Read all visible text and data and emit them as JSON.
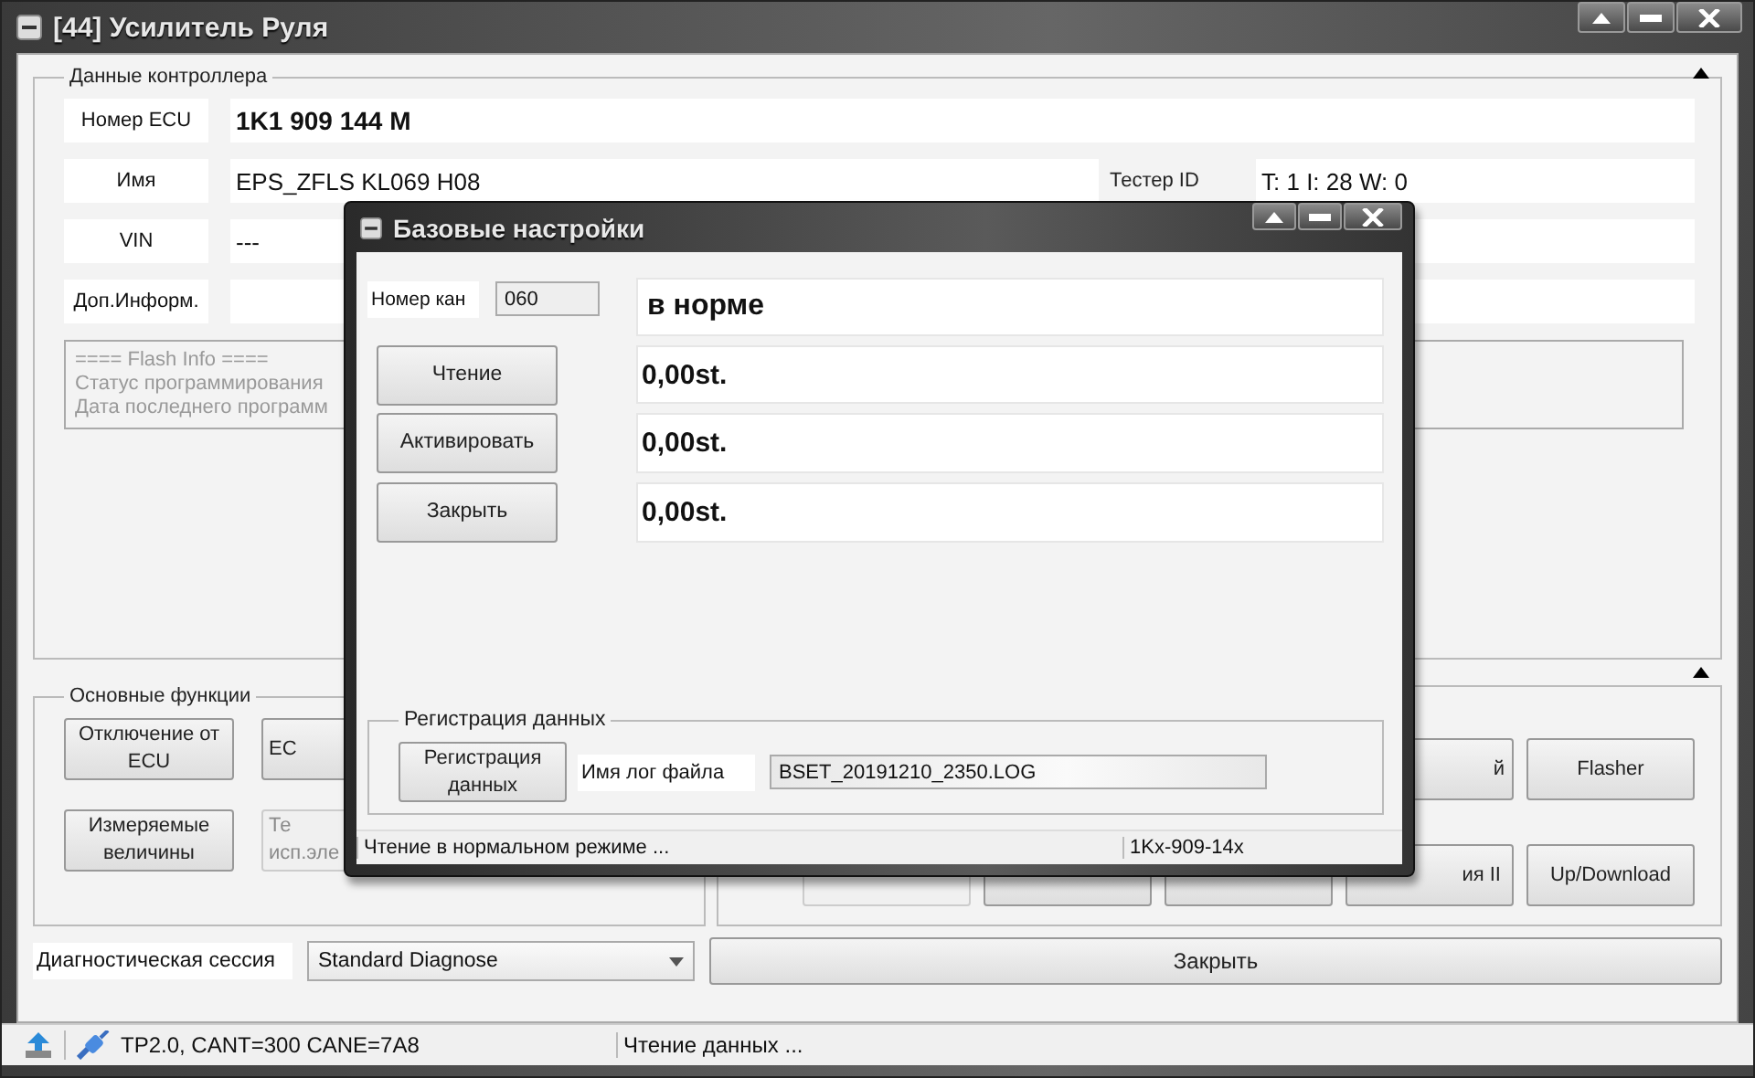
{
  "window": {
    "title": "[44] Усилитель Руля"
  },
  "controller_data": {
    "title": "Данные контроллера",
    "fields": [
      {
        "label": "Номер ECU",
        "value": "1K1 909 144 M",
        "bold": true
      },
      {
        "label": "Имя",
        "value": "EPS_ZFLS KL069 H08",
        "bold": false,
        "extra_label": "Тестер ID",
        "extra_value": "T: 1 I: 28 W: 0"
      },
      {
        "label": "VIN",
        "value": "---",
        "bold": false
      },
      {
        "label": "Доп.Информ."
      }
    ]
  },
  "flash_info": [
    "==== Flash Info ====",
    "Статус программирования",
    "Дата последнего программ"
  ],
  "basic_functions": {
    "title": "Основные функции",
    "rows": [
      [
        {
          "label": "Отключение от\nECU",
          "disabled": false
        },
        {
          "label": "EC",
          "disabled": false
        }
      ],
      [
        {
          "label": "Измеряемые\nвеличины",
          "disabled": false
        },
        {
          "label": "Те\nисп.эле",
          "disabled": true
        }
      ]
    ]
  },
  "advanced_functions": {
    "rows": [
      [
        {
          "label": "й",
          "disabled": false
        },
        {
          "label": "Flasher",
          "disabled": false
        }
      ],
      [
        {
          "disabled": true
        },
        {
          "disabled": false
        },
        {
          "disabled": false
        },
        {
          "label": "ия II",
          "disabled": false
        },
        {
          "label": "Up/Download",
          "disabled": false
        }
      ]
    ]
  },
  "session": {
    "label": "Диагностическая сессия",
    "value": "Standard Diagnose"
  },
  "close_button": "Закрыть",
  "status_bar": {
    "connection": "TP2.0, CANT=300 CANE=7A8",
    "message": "Чтение данных ..."
  },
  "dialog": {
    "title": "Базовые настройки",
    "channel_label": "Номер кан",
    "channel_value": "060",
    "status": "в норме",
    "buttons": [
      "Чтение",
      "Активировать",
      "Закрыть"
    ],
    "readings": [
      "0,00st.",
      "0,00st.",
      "0,00st."
    ],
    "logging": {
      "title": "Регистрация данных",
      "button": "Регистрация\nданных",
      "file_label": "Имя лог файла",
      "file_value": "BSET_20191210_2350.LOG"
    },
    "status_bar": {
      "message": "Чтение в нормальном режиме ...",
      "ecu": "1Kx-909-14x"
    }
  }
}
